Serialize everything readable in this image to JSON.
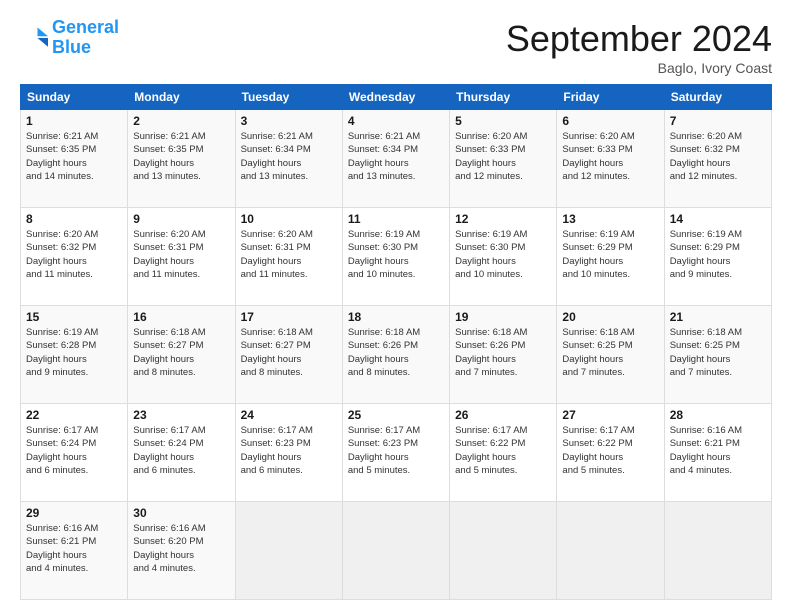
{
  "logo": {
    "line1": "General",
    "line2": "Blue"
  },
  "title": "September 2024",
  "location": "Baglo, Ivory Coast",
  "days_header": [
    "Sunday",
    "Monday",
    "Tuesday",
    "Wednesday",
    "Thursday",
    "Friday",
    "Saturday"
  ],
  "weeks": [
    [
      {
        "day": "1",
        "sunrise": "6:21 AM",
        "sunset": "6:35 PM",
        "daylight": "12 hours and 14 minutes."
      },
      {
        "day": "2",
        "sunrise": "6:21 AM",
        "sunset": "6:35 PM",
        "daylight": "12 hours and 13 minutes."
      },
      {
        "day": "3",
        "sunrise": "6:21 AM",
        "sunset": "6:34 PM",
        "daylight": "12 hours and 13 minutes."
      },
      {
        "day": "4",
        "sunrise": "6:21 AM",
        "sunset": "6:34 PM",
        "daylight": "12 hours and 13 minutes."
      },
      {
        "day": "5",
        "sunrise": "6:20 AM",
        "sunset": "6:33 PM",
        "daylight": "12 hours and 12 minutes."
      },
      {
        "day": "6",
        "sunrise": "6:20 AM",
        "sunset": "6:33 PM",
        "daylight": "12 hours and 12 minutes."
      },
      {
        "day": "7",
        "sunrise": "6:20 AM",
        "sunset": "6:32 PM",
        "daylight": "12 hours and 12 minutes."
      }
    ],
    [
      {
        "day": "8",
        "sunrise": "6:20 AM",
        "sunset": "6:32 PM",
        "daylight": "12 hours and 11 minutes."
      },
      {
        "day": "9",
        "sunrise": "6:20 AM",
        "sunset": "6:31 PM",
        "daylight": "12 hours and 11 minutes."
      },
      {
        "day": "10",
        "sunrise": "6:20 AM",
        "sunset": "6:31 PM",
        "daylight": "12 hours and 11 minutes."
      },
      {
        "day": "11",
        "sunrise": "6:19 AM",
        "sunset": "6:30 PM",
        "daylight": "12 hours and 10 minutes."
      },
      {
        "day": "12",
        "sunrise": "6:19 AM",
        "sunset": "6:30 PM",
        "daylight": "12 hours and 10 minutes."
      },
      {
        "day": "13",
        "sunrise": "6:19 AM",
        "sunset": "6:29 PM",
        "daylight": "12 hours and 10 minutes."
      },
      {
        "day": "14",
        "sunrise": "6:19 AM",
        "sunset": "6:29 PM",
        "daylight": "12 hours and 9 minutes."
      }
    ],
    [
      {
        "day": "15",
        "sunrise": "6:19 AM",
        "sunset": "6:28 PM",
        "daylight": "12 hours and 9 minutes."
      },
      {
        "day": "16",
        "sunrise": "6:18 AM",
        "sunset": "6:27 PM",
        "daylight": "12 hours and 8 minutes."
      },
      {
        "day": "17",
        "sunrise": "6:18 AM",
        "sunset": "6:27 PM",
        "daylight": "12 hours and 8 minutes."
      },
      {
        "day": "18",
        "sunrise": "6:18 AM",
        "sunset": "6:26 PM",
        "daylight": "12 hours and 8 minutes."
      },
      {
        "day": "19",
        "sunrise": "6:18 AM",
        "sunset": "6:26 PM",
        "daylight": "12 hours and 7 minutes."
      },
      {
        "day": "20",
        "sunrise": "6:18 AM",
        "sunset": "6:25 PM",
        "daylight": "12 hours and 7 minutes."
      },
      {
        "day": "21",
        "sunrise": "6:18 AM",
        "sunset": "6:25 PM",
        "daylight": "12 hours and 7 minutes."
      }
    ],
    [
      {
        "day": "22",
        "sunrise": "6:17 AM",
        "sunset": "6:24 PM",
        "daylight": "12 hours and 6 minutes."
      },
      {
        "day": "23",
        "sunrise": "6:17 AM",
        "sunset": "6:24 PM",
        "daylight": "12 hours and 6 minutes."
      },
      {
        "day": "24",
        "sunrise": "6:17 AM",
        "sunset": "6:23 PM",
        "daylight": "12 hours and 6 minutes."
      },
      {
        "day": "25",
        "sunrise": "6:17 AM",
        "sunset": "6:23 PM",
        "daylight": "12 hours and 5 minutes."
      },
      {
        "day": "26",
        "sunrise": "6:17 AM",
        "sunset": "6:22 PM",
        "daylight": "12 hours and 5 minutes."
      },
      {
        "day": "27",
        "sunrise": "6:17 AM",
        "sunset": "6:22 PM",
        "daylight": "12 hours and 5 minutes."
      },
      {
        "day": "28",
        "sunrise": "6:16 AM",
        "sunset": "6:21 PM",
        "daylight": "12 hours and 4 minutes."
      }
    ],
    [
      {
        "day": "29",
        "sunrise": "6:16 AM",
        "sunset": "6:21 PM",
        "daylight": "12 hours and 4 minutes."
      },
      {
        "day": "30",
        "sunrise": "6:16 AM",
        "sunset": "6:20 PM",
        "daylight": "12 hours and 4 minutes."
      },
      null,
      null,
      null,
      null,
      null
    ]
  ]
}
